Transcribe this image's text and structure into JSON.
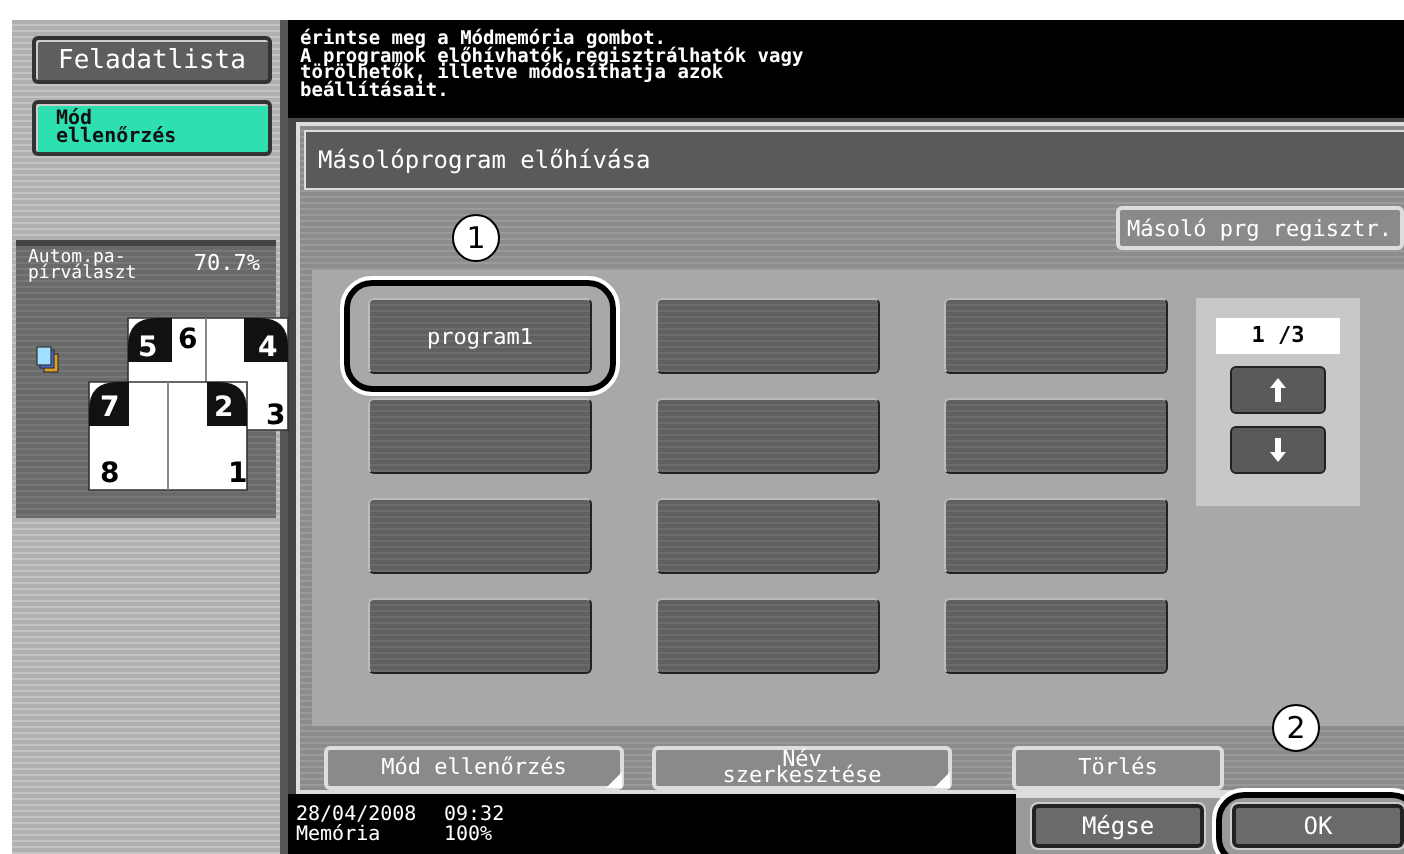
{
  "sidebar": {
    "job_list_button": "Feladatlista",
    "mode_check_button": {
      "label": "Mód\nellenőrzés",
      "selected": true
    },
    "preview": {
      "paper_label": "Autom.pa-\npírválaszt",
      "zoom": "70.7%",
      "page_numbers": [
        "5",
        "6",
        "4",
        "7",
        "2",
        "3",
        "8",
        "1"
      ]
    }
  },
  "message": "érintse meg a Módmemória gombot.\nA programok előhívhatók,regisztrálhatók vagy\ntörölhetők, illetve módosíthatja azok\nbeállításait.",
  "dialog": {
    "title": "Másolóprogram előhívása",
    "register_button": "Másoló prg regisztr.",
    "programs": [
      {
        "kind": "named",
        "label": "program1",
        "callout": "1"
      },
      {
        "kind": "empty"
      },
      {
        "kind": "empty"
      },
      {
        "kind": "empty"
      },
      {
        "kind": "empty"
      },
      {
        "kind": "empty"
      },
      {
        "kind": "empty"
      },
      {
        "kind": "empty"
      },
      {
        "kind": "empty"
      },
      {
        "kind": "empty"
      },
      {
        "kind": "empty"
      },
      {
        "kind": "empty"
      }
    ],
    "pager": {
      "page": "1 /3"
    },
    "actions": [
      {
        "label": "Mód ellenőrzés",
        "kind": "menu"
      },
      {
        "label": "Név\nszerkesztése",
        "kind": "menu"
      },
      {
        "label": "Törlés",
        "kind": "plain"
      }
    ]
  },
  "status_bar": {
    "date": "28/04/2008",
    "time": "09:32",
    "memory_label": "Memória",
    "memory": "100%"
  },
  "buttons": [
    {
      "label": "Mégse"
    },
    {
      "label": "OK",
      "callout": "2"
    }
  ]
}
